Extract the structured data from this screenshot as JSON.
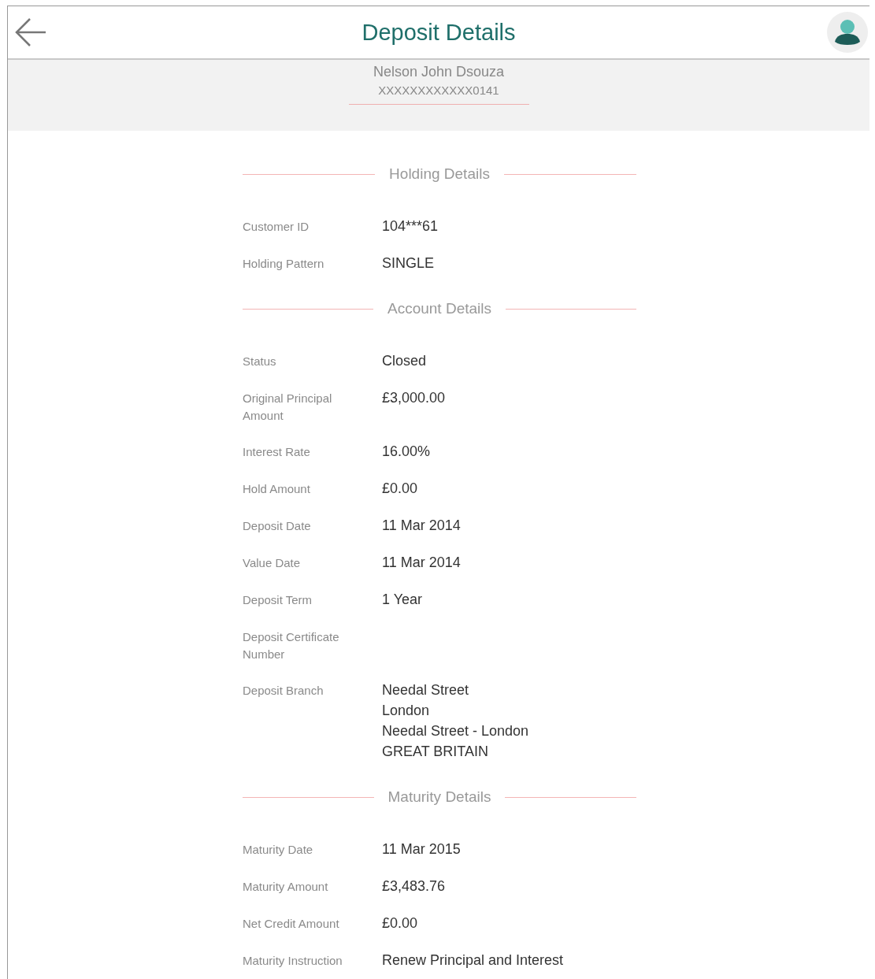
{
  "header": {
    "title": "Deposit Details"
  },
  "account": {
    "name": "Nelson John Dsouza",
    "number": "XXXXXXXXXXXX0141"
  },
  "sections": [
    {
      "title": "Holding Details",
      "rows": [
        {
          "label": "Customer ID",
          "lines": [
            "104***61"
          ]
        },
        {
          "label": "Holding Pattern",
          "lines": [
            "SINGLE"
          ]
        }
      ]
    },
    {
      "title": "Account Details",
      "rows": [
        {
          "label": "Status",
          "lines": [
            "Closed"
          ]
        },
        {
          "label": "Original Principal Amount",
          "lines": [
            "£3,000.00"
          ]
        },
        {
          "label": "Interest Rate",
          "lines": [
            "16.00%"
          ]
        },
        {
          "label": "Hold Amount",
          "lines": [
            "£0.00"
          ]
        },
        {
          "label": "Deposit Date",
          "lines": [
            "11 Mar 2014"
          ]
        },
        {
          "label": "Value Date",
          "lines": [
            "11 Mar 2014"
          ]
        },
        {
          "label": "Deposit Term",
          "lines": [
            "1 Year"
          ]
        },
        {
          "label": "Deposit Certificate Number",
          "lines": []
        },
        {
          "label": "Deposit Branch",
          "lines": [
            "Needal Street",
            "London",
            "Needal Street - London",
            "GREAT BRITAIN"
          ]
        }
      ]
    },
    {
      "title": "Maturity Details",
      "rows": [
        {
          "label": "Maturity Date",
          "lines": [
            "11 Mar 2015"
          ]
        },
        {
          "label": "Maturity Amount",
          "lines": [
            "£3,483.76"
          ]
        },
        {
          "label": "Net Credit Amount",
          "lines": [
            "£0.00"
          ]
        },
        {
          "label": "Maturity Instruction",
          "lines": [
            "Renew Principal and Interest"
          ]
        }
      ]
    }
  ]
}
